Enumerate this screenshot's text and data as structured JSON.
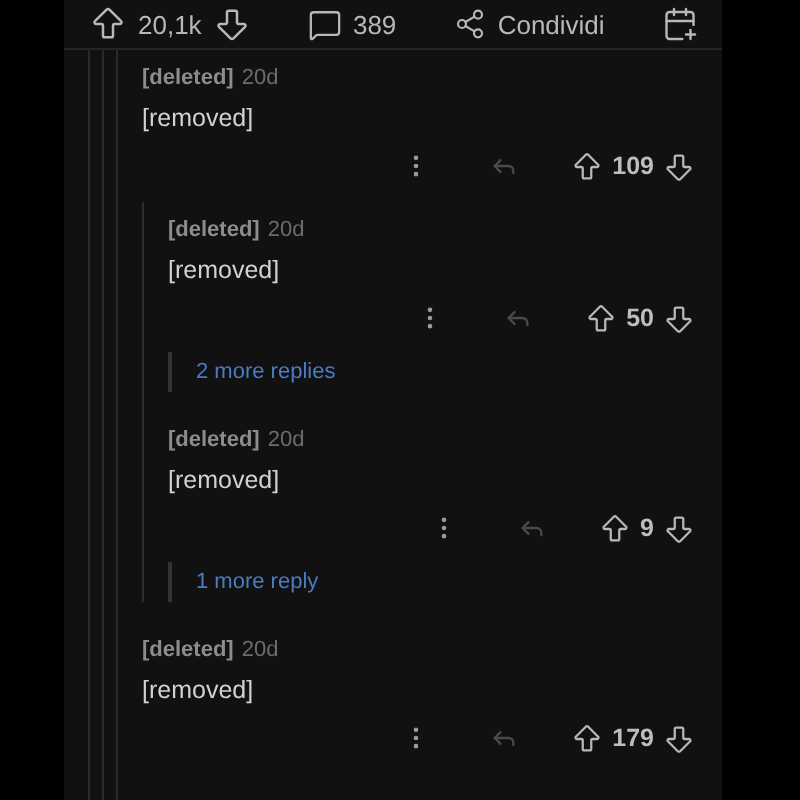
{
  "toolbar": {
    "score": "20,1k",
    "comments": "389",
    "share": "Condividi"
  },
  "comments": [
    {
      "author": "[deleted]",
      "age": "20d",
      "body": "[removed]",
      "score": "109",
      "children": [
        {
          "author": "[deleted]",
          "age": "20d",
          "body": "[removed]",
          "score": "50",
          "more": "2 more replies"
        },
        {
          "author": "[deleted]",
          "age": "20d",
          "body": "[removed]",
          "score": "9",
          "more": "1 more reply"
        }
      ]
    },
    {
      "author": "[deleted]",
      "age": "20d",
      "body": "[removed]",
      "score": "179"
    }
  ]
}
